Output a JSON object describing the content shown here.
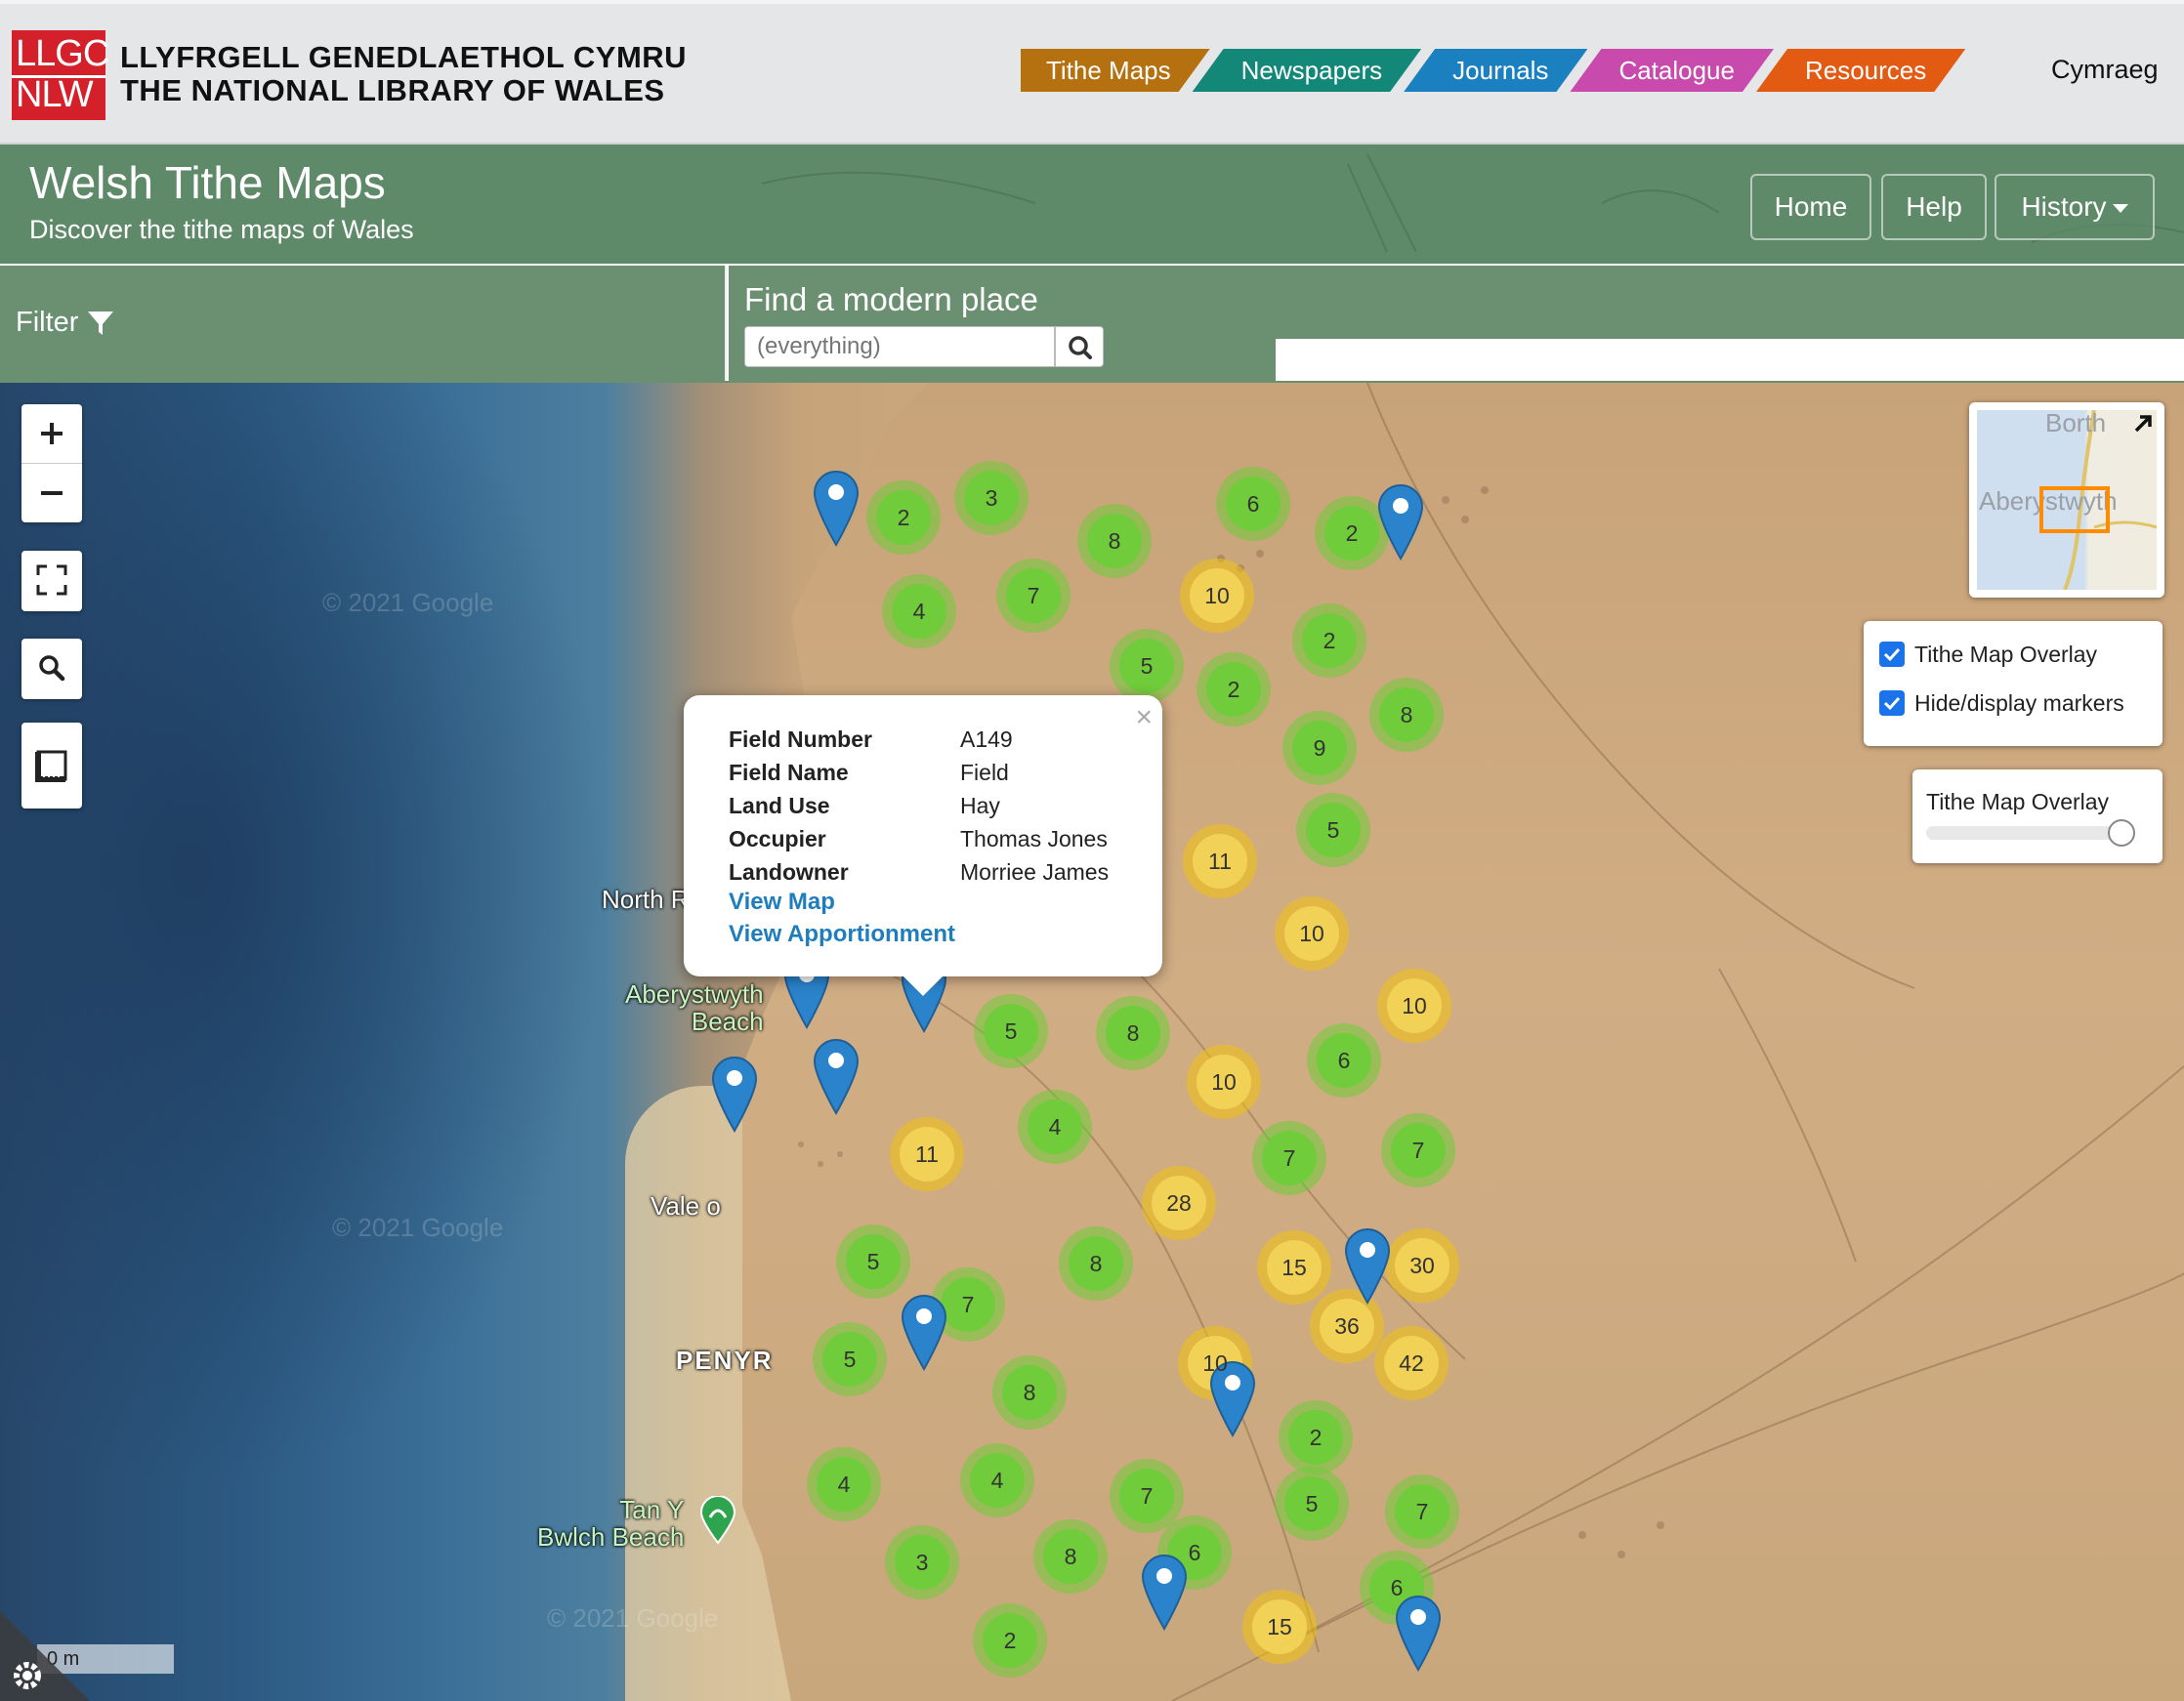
{
  "library": {
    "logo_top": "LLGC",
    "logo_bottom": "NLW",
    "name_welsh": "LLYFRGELL GENEDLAETHOL CYMRU",
    "name_english": "THE NATIONAL LIBRARY OF WALES"
  },
  "nav_tabs": [
    {
      "label": "Tithe Maps",
      "color": "#b5700f"
    },
    {
      "label": "Newspapers",
      "color": "#138879"
    },
    {
      "label": "Journals",
      "color": "#1a80c0"
    },
    {
      "label": "Catalogue",
      "color": "#c94aad"
    },
    {
      "label": "Resources",
      "color": "#e35a13"
    }
  ],
  "language_link": "Cymraeg",
  "site": {
    "title": "Welsh Tithe Maps",
    "subtitle": "Discover the tithe maps of Wales",
    "buttons": {
      "home": "Home",
      "help": "Help",
      "history": "History"
    }
  },
  "filter": {
    "label": "Filter"
  },
  "search": {
    "label": "Find a modern place",
    "placeholder": "(everything)"
  },
  "map_labels": {
    "north": "North R",
    "beach1": "Aberystwyth",
    "beach2": "Beach",
    "vale": "Vale o",
    "penyr": "PENYR",
    "tany1": "Tan Y",
    "tany2": "Bwlch Beach",
    "scale": "0 m"
  },
  "clusters": [
    {
      "n": "2",
      "c": "green"
    },
    {
      "n": "3",
      "c": "green"
    },
    {
      "n": "8",
      "c": "green"
    },
    {
      "n": "6",
      "c": "green"
    },
    {
      "n": "2",
      "c": "green"
    },
    {
      "n": "4",
      "c": "green"
    },
    {
      "n": "7",
      "c": "green"
    },
    {
      "n": "10",
      "c": "yellow"
    },
    {
      "n": "2",
      "c": "green"
    },
    {
      "n": "5",
      "c": "green"
    },
    {
      "n": "2",
      "c": "green"
    },
    {
      "n": "8",
      "c": "green"
    },
    {
      "n": "9",
      "c": "green"
    },
    {
      "n": "11",
      "c": "yellow"
    },
    {
      "n": "5",
      "c": "green"
    },
    {
      "n": "10",
      "c": "yellow"
    },
    {
      "n": "10",
      "c": "yellow"
    },
    {
      "n": "5",
      "c": "green"
    },
    {
      "n": "8",
      "c": "green"
    },
    {
      "n": "6",
      "c": "green"
    },
    {
      "n": "10",
      "c": "yellow"
    },
    {
      "n": "4",
      "c": "green"
    },
    {
      "n": "11",
      "c": "yellow"
    },
    {
      "n": "7",
      "c": "green"
    },
    {
      "n": "7",
      "c": "green"
    },
    {
      "n": "28",
      "c": "yellow"
    },
    {
      "n": "8",
      "c": "green"
    },
    {
      "n": "15",
      "c": "yellow"
    },
    {
      "n": "30",
      "c": "yellow"
    },
    {
      "n": "5",
      "c": "green"
    },
    {
      "n": "7",
      "c": "green"
    },
    {
      "n": "36",
      "c": "yellow"
    },
    {
      "n": "42",
      "c": "yellow"
    },
    {
      "n": "5",
      "c": "green"
    },
    {
      "n": "8",
      "c": "green"
    },
    {
      "n": "10",
      "c": "yellow"
    },
    {
      "n": "2",
      "c": "green"
    },
    {
      "n": "4",
      "c": "green"
    },
    {
      "n": "4",
      "c": "green"
    },
    {
      "n": "7",
      "c": "green"
    },
    {
      "n": "5",
      "c": "green"
    },
    {
      "n": "7",
      "c": "green"
    },
    {
      "n": "3",
      "c": "green"
    },
    {
      "n": "8",
      "c": "green"
    },
    {
      "n": "6",
      "c": "green"
    },
    {
      "n": "6",
      "c": "green"
    },
    {
      "n": "2",
      "c": "green"
    },
    {
      "n": "15",
      "c": "yellow"
    }
  ],
  "popup": {
    "rows": [
      {
        "k": "Field Number",
        "v": "A149"
      },
      {
        "k": "Field Name",
        "v": "Field"
      },
      {
        "k": "Land Use",
        "v": "Hay"
      },
      {
        "k": "Occupier",
        "v": "Thomas Jones"
      },
      {
        "k": "Landowner",
        "v": "Morriee James"
      }
    ],
    "view_map": "View Map",
    "view_apportionment": "View Apportionment",
    "close": "×"
  },
  "minimap": {
    "label1": "Borth",
    "label2": "Aberystwyth"
  },
  "layers": {
    "tithe_overlay": "Tithe Map Overlay",
    "markers": "Hide/display markers"
  },
  "opacity": {
    "label": "Tithe Map Overlay",
    "value": 1.0
  },
  "colors": {
    "banner": "#5f8a6a",
    "toolbar": "#6a8f71",
    "pin": "#2b83cb",
    "link": "#1e7dbd"
  }
}
